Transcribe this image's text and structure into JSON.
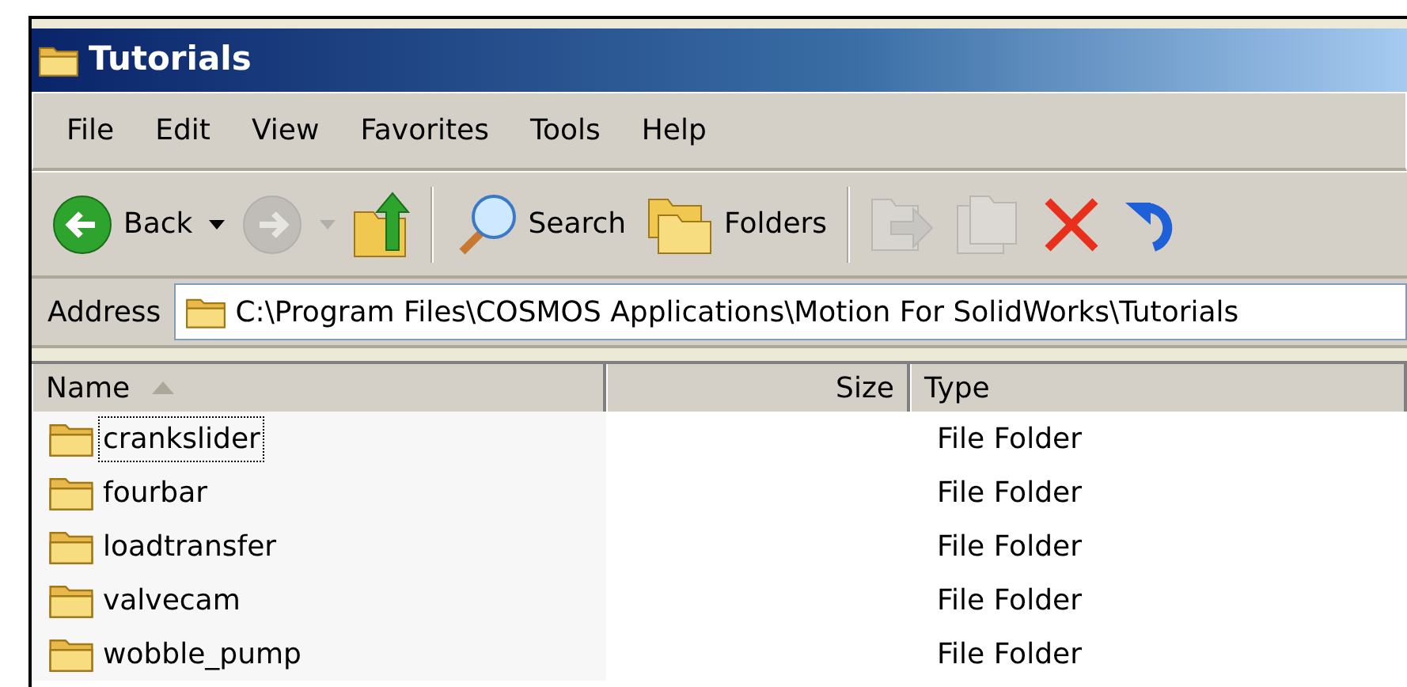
{
  "window": {
    "title": "Tutorials"
  },
  "menu": [
    "File",
    "Edit",
    "View",
    "Favorites",
    "Tools",
    "Help"
  ],
  "toolbar": [
    {
      "kind": "back",
      "label": "Back",
      "disabled": false,
      "dropdown": true
    },
    {
      "kind": "forward",
      "disabled": true,
      "dropdown": true
    },
    {
      "kind": "up",
      "disabled": false
    },
    {
      "kind": "separator"
    },
    {
      "kind": "search",
      "label": "Search",
      "disabled": false
    },
    {
      "kind": "folders",
      "label": "Folders",
      "disabled": false
    },
    {
      "kind": "separator"
    },
    {
      "kind": "move",
      "disabled": true
    },
    {
      "kind": "copy",
      "disabled": true
    },
    {
      "kind": "delete",
      "disabled": false
    },
    {
      "kind": "undo",
      "disabled": false
    }
  ],
  "address": {
    "label": "Address",
    "value": "C:\\Program Files\\COSMOS Applications\\Motion For SolidWorks\\Tutorials"
  },
  "table": {
    "columns": [
      {
        "label": "Name",
        "sorted": true
      },
      {
        "label": "Size",
        "sorted": false
      },
      {
        "label": "Type",
        "sorted": false
      }
    ],
    "rows": [
      {
        "name": "crankslider",
        "type": "File Folder",
        "focused": true
      },
      {
        "name": "fourbar",
        "type": "File Folder",
        "focused": false
      },
      {
        "name": "loadtransfer",
        "type": "File Folder",
        "focused": false
      },
      {
        "name": "valvecam",
        "type": "File Folder",
        "focused": false
      },
      {
        "name": "wobble_pump",
        "type": "File Folder",
        "focused": false
      }
    ]
  }
}
